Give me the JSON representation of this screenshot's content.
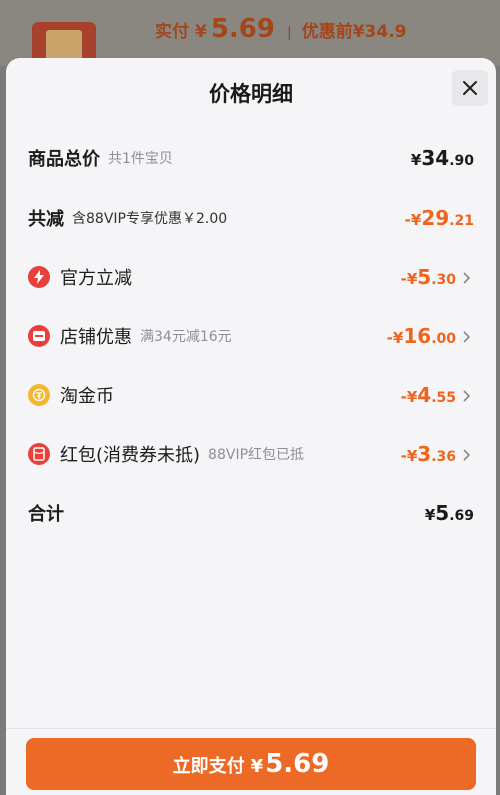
{
  "header": {
    "paid_label": "实付",
    "paid_currency": "¥",
    "paid_amount": "5.69",
    "separator": "|",
    "original_label": "优惠前¥34.9"
  },
  "sheet": {
    "title": "价格明细",
    "close_icon": "close-icon"
  },
  "rows": {
    "total": {
      "label": "商品总价",
      "sub": "共1件宝贝",
      "currency": "¥",
      "int": "34",
      "dec": ".90"
    },
    "discount": {
      "label": "共减",
      "sub": "含88VIP专享优惠￥2.00",
      "prefix": "-¥",
      "int": "29",
      "dec": ".21"
    },
    "official": {
      "label": "官方立减",
      "prefix": "-¥",
      "int": "5",
      "dec": ".30",
      "icon": "lightning-icon"
    },
    "store": {
      "label": "店铺优惠",
      "sub": "满34元减16元",
      "prefix": "-¥",
      "int": "16",
      "dec": ".00",
      "icon": "store-coupon-icon"
    },
    "coins": {
      "label": "淘金币",
      "prefix": "-¥",
      "int": "4",
      "dec": ".55",
      "icon": "coin-icon"
    },
    "redpacket": {
      "label": "红包(消费券未抵)",
      "sub": "88VIP红包已抵",
      "prefix": "-¥",
      "int": "3",
      "dec": ".36",
      "icon": "red-packet-icon"
    },
    "sum": {
      "label": "合计",
      "currency": "¥",
      "int": "5",
      "dec": ".69"
    }
  },
  "pay_button": {
    "label": "立即支付",
    "currency": "¥",
    "amount": "5.69"
  },
  "colors": {
    "accent": "#ec6a26",
    "discount": "#f0641e",
    "icon_red": "#e8413c",
    "icon_gold": "#f5b62e"
  }
}
